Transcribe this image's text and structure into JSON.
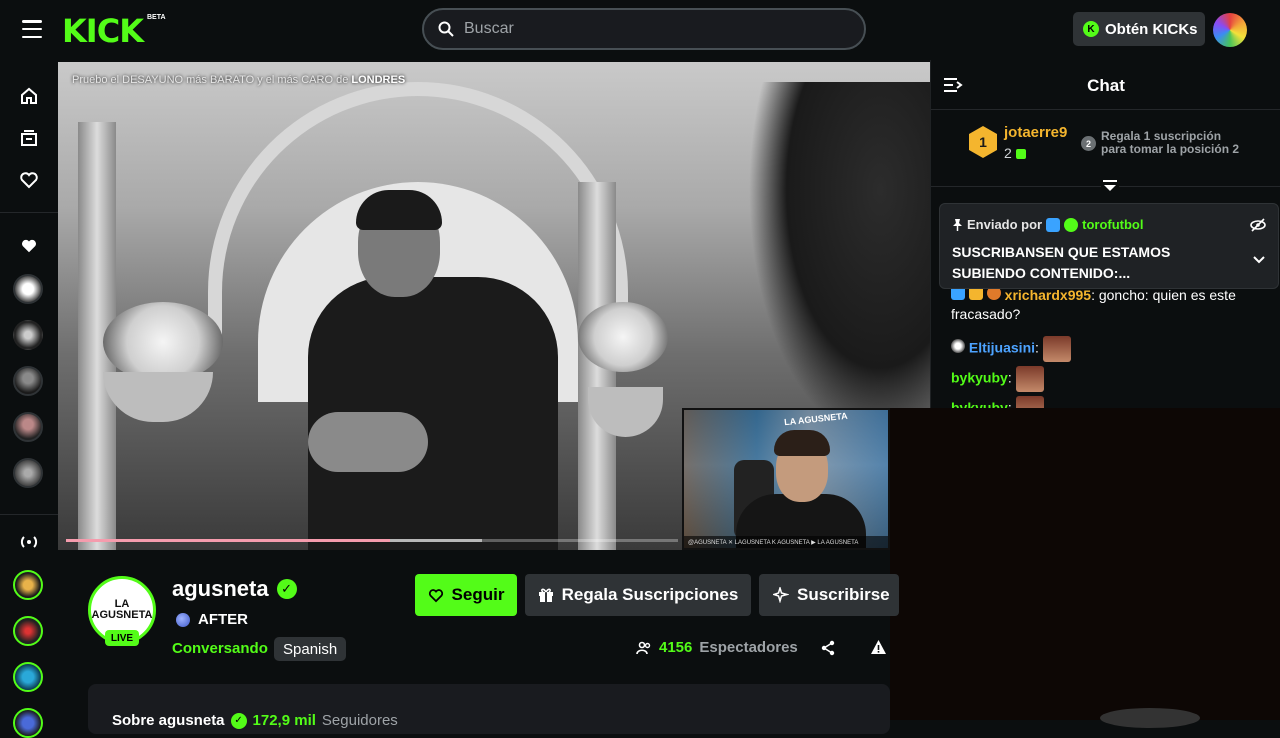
{
  "topbar": {
    "logo": "KICK",
    "beta": "BETA",
    "search_placeholder": "Buscar",
    "kicks_button": "Obtén KICKs",
    "kicks_coin": "K"
  },
  "video": {
    "title_pre": "Pruebo el DESAYUNO más BARATO y el más CARO de ",
    "title_bold": "LONDRES",
    "progress": 0.53,
    "buffered": 0.68,
    "cam_logo": "LA AGUSNETA",
    "cam_footer": "@AGUSNETA  ✕ LAGUSNETA  K AGUSNETA  ▶ LA AGUSNETA"
  },
  "chat": {
    "title": "Chat",
    "leader": {
      "rank": "1",
      "name": "jotaerre9",
      "count": "2",
      "rank2": "2",
      "cta_line1": "Regala 1 suscripción",
      "cta_line2": "para tomar la posición 2"
    },
    "pinned": {
      "by_label": "Enviado por",
      "user": "torofutbol",
      "text": "SUSCRIBANSEN QUE ESTAMOS SUBIENDO CONTENIDO:..."
    },
    "messages": [
      {
        "user": "xrichardx995",
        "sep": ": ",
        "text": "goncho: quien es este fracasado?",
        "color": "#f4b52e"
      },
      {
        "user": "Eltijuasini",
        "sep": ":",
        "text": "",
        "color": "#4da3ff"
      },
      {
        "user": "bykyuby",
        "sep": ":",
        "text": "",
        "color": "#53fc18"
      },
      {
        "user": "bykyuby",
        "sep": ":",
        "text": "",
        "color": "#53fc18"
      }
    ]
  },
  "channel": {
    "avatar_text": "LA AGUSNETA",
    "live": "LIVE",
    "name": "agusneta",
    "stream_title": "AFTER",
    "category": "Conversando",
    "language": "Spanish",
    "follow_label": "Seguir",
    "gift_label": "Regala Suscripciones",
    "subscribe_label": "Suscribirse",
    "viewers_count": "4156",
    "viewers_label": "Espectadores",
    "about_prefix": "Sobre agusneta",
    "followers_count": "172,9 mil",
    "followers_label": "Seguidores"
  },
  "colors": {
    "accent": "#53fc18",
    "background": "#0b0e0f",
    "button": "#2f3336",
    "progress": "#e9244b"
  }
}
